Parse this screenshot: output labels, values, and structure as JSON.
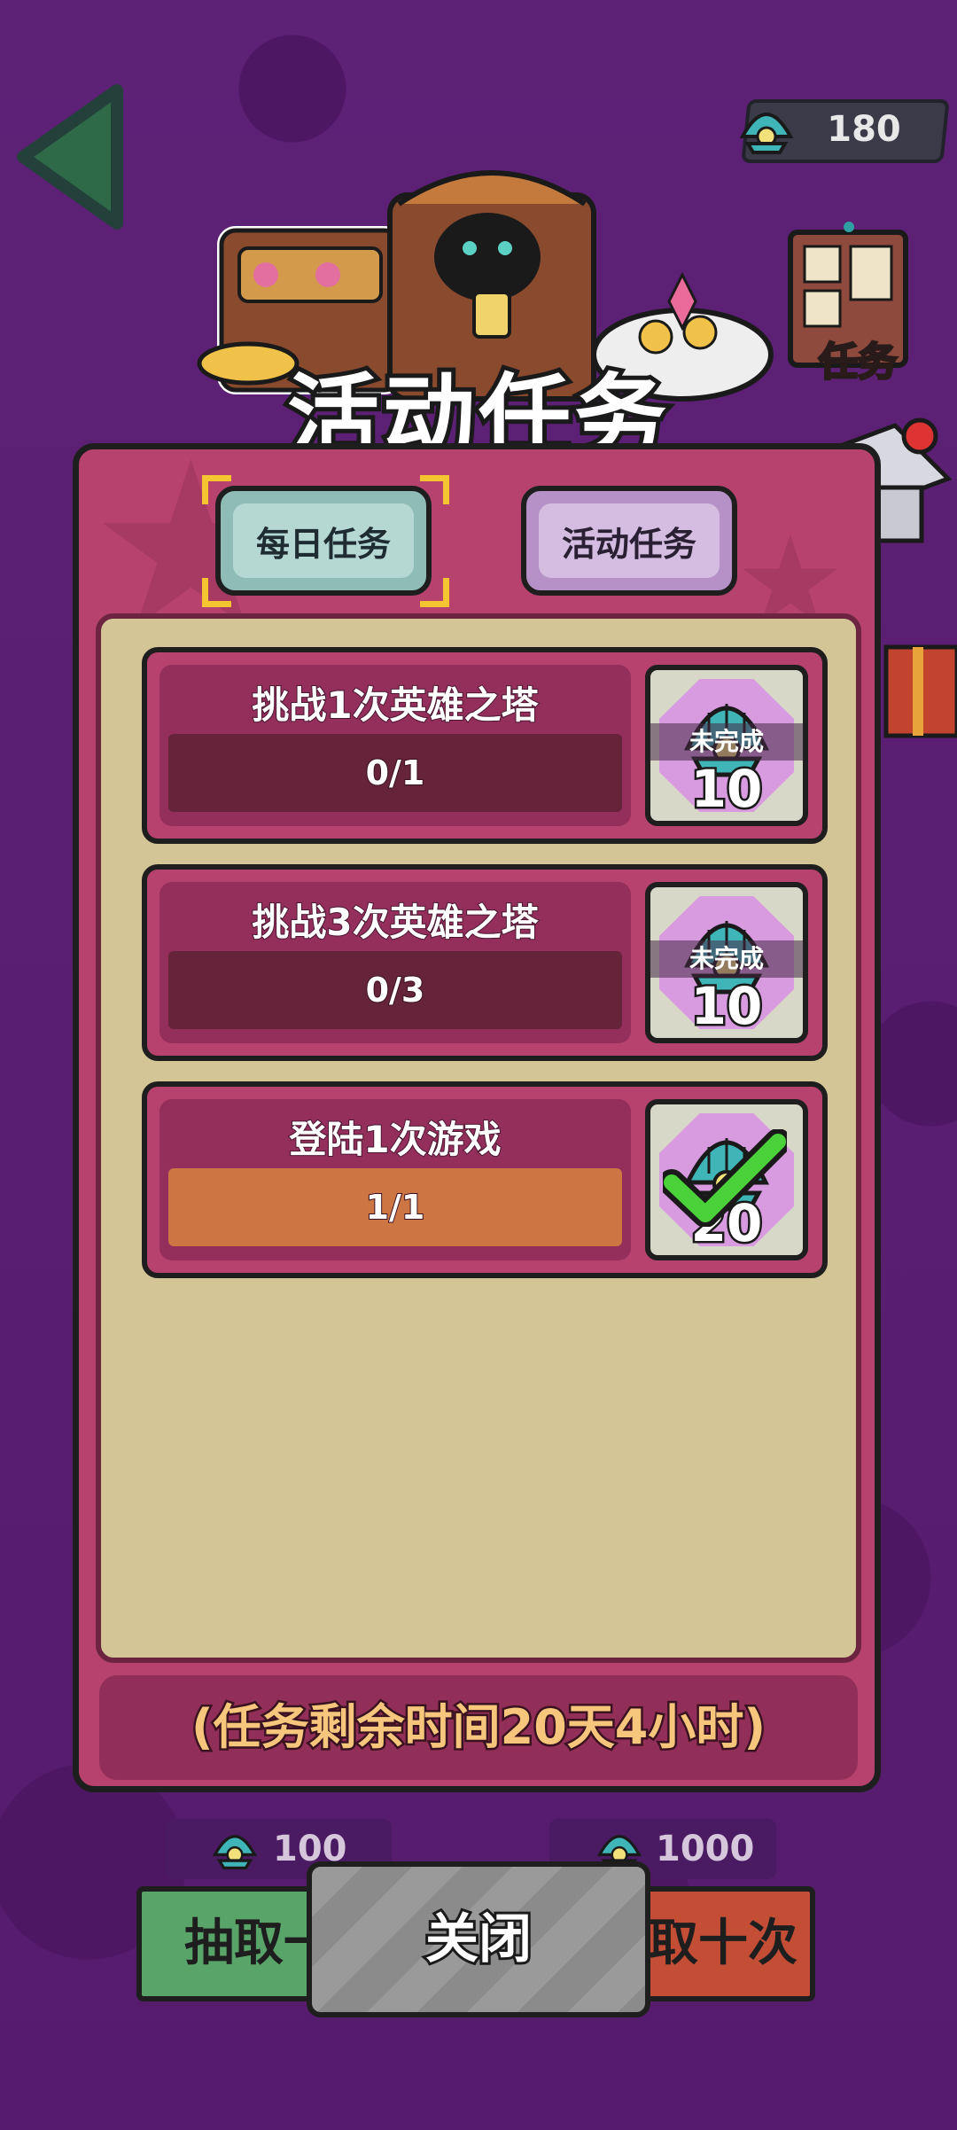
{
  "header": {
    "title": "活动任务"
  },
  "currency": {
    "icon": "shell-icon",
    "amount": "180"
  },
  "side_menu": {
    "task_label": "任务"
  },
  "tabs": [
    {
      "label": "每日任务",
      "selected": true
    },
    {
      "label": "活动任务",
      "selected": false
    }
  ],
  "tasks": [
    {
      "title": "挑战1次英雄之塔",
      "progress": "0/1",
      "progress_fraction": 0,
      "status": "未完成",
      "reward": "10",
      "completed": false
    },
    {
      "title": "挑战3次英雄之塔",
      "progress": "0/3",
      "progress_fraction": 0,
      "status": "未完成",
      "reward": "10",
      "completed": false
    },
    {
      "title": "登陆1次游戏",
      "progress": "1/1",
      "progress_fraction": 1,
      "status": "",
      "reward": "20",
      "completed": true
    }
  ],
  "timer": "(任务剩余时间20天4小时)",
  "bottom": {
    "draw_one_cost": "100",
    "draw_one_label": "抽取一",
    "draw_ten_cost": "1000",
    "draw_ten_label": "取十次",
    "close_label": "关闭"
  },
  "colors": {
    "accent": "#b8426e",
    "progress_fill": "#cd7644",
    "check": "#4bd13a"
  }
}
